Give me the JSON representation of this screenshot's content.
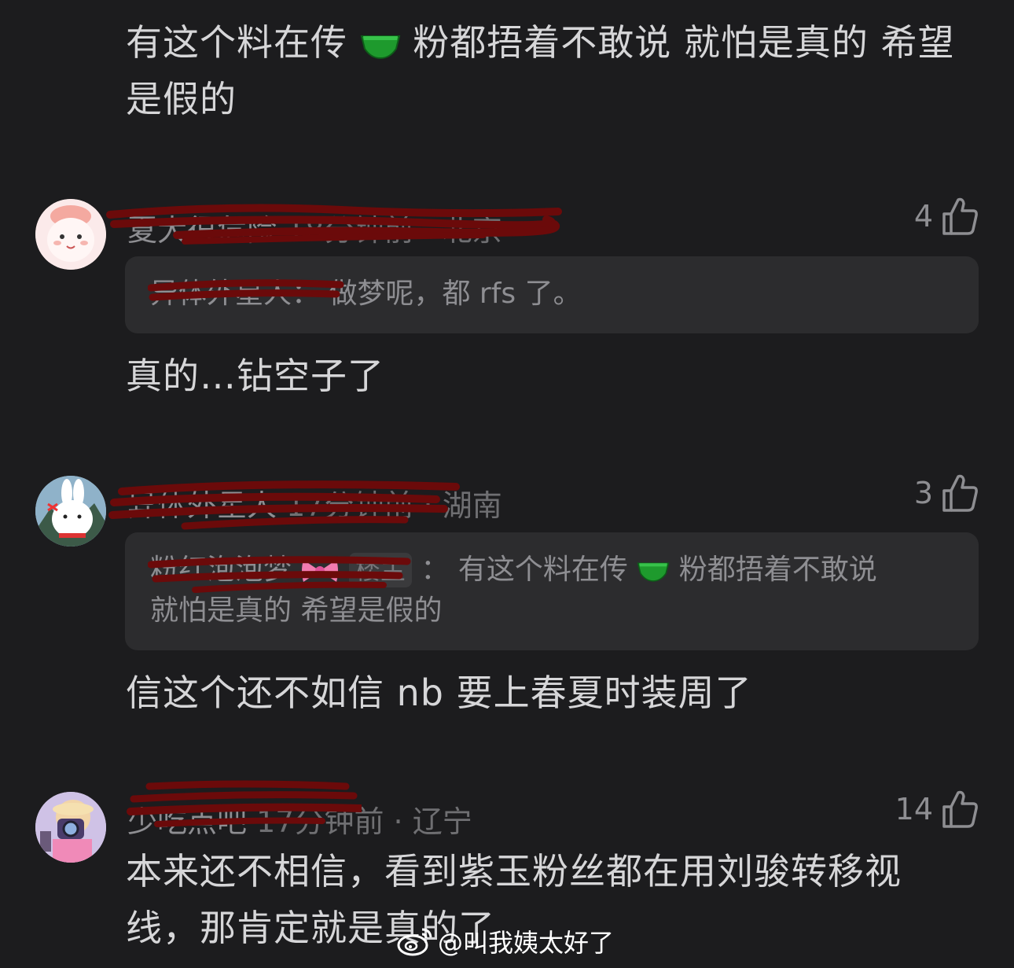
{
  "top_comment": {
    "part1": "有这个料在传",
    "part2": "粉都捂着不敢说 就怕是真的 希望",
    "part3": "是假的"
  },
  "comments": [
    {
      "username": "夏大很危险",
      "meta": "18分钟前 · 北京",
      "likes": "4",
      "quote_user": "异体外星人",
      "quote_text": "做梦呢，都 rfs 了。",
      "body": "真的…钻空子了"
    },
    {
      "username": "异体外星人",
      "meta": "17分钟前 · 湖南",
      "likes": "3",
      "quote_user": "粉红泡泡梦",
      "quote_badge": "楼主",
      "quote_sep": "：",
      "quote_line1": "有这个料在传",
      "quote_line1b": "粉都捂着不敢说",
      "quote_line2": "就怕是真的 希望是假的",
      "body": "信这个还不如信 nb 要上春夏时装周了"
    },
    {
      "username": "少吃点吧",
      "meta": "17分钟前 · 辽宁",
      "likes": "14",
      "body_line1": "本来还不相信，看到紫玉粉丝都在用刘骏转移视",
      "body_line2": "线，那肯定就是真的了"
    }
  ],
  "watermark": "@叫我姨太好了",
  "colors": {
    "background": "#1c1c1e",
    "quote_bg": "#2c2c2e",
    "redact": "#6b0a0a"
  }
}
